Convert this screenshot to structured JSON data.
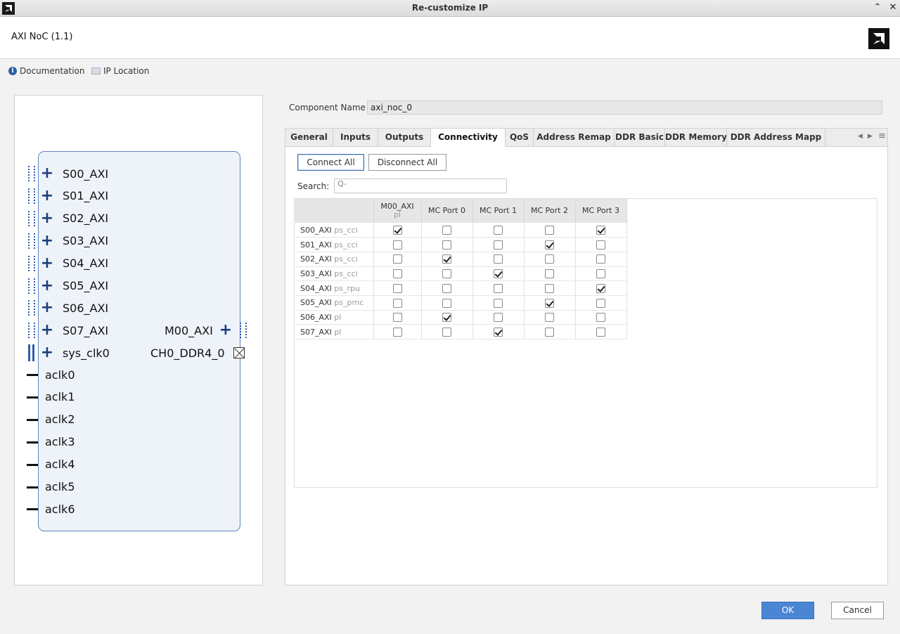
{
  "window": {
    "title": "Re-customize IP"
  },
  "header": {
    "ip_name": "AXI NoC (1.1)"
  },
  "links": {
    "documentation": "Documentation",
    "ip_location": "IP Location"
  },
  "block": {
    "slave_ports": [
      "S00_AXI",
      "S01_AXI",
      "S02_AXI",
      "S03_AXI",
      "S04_AXI",
      "S05_AXI",
      "S06_AXI",
      "S07_AXI"
    ],
    "sys_clk": "sys_clk0",
    "master_port": "M00_AXI",
    "ddr_port": "CH0_DDR4_0",
    "clocks": [
      "aclk0",
      "aclk1",
      "aclk2",
      "aclk3",
      "aclk4",
      "aclk5",
      "aclk6"
    ]
  },
  "component": {
    "label": "Component Name",
    "value": "axi_noc_0"
  },
  "tabs": [
    "General",
    "Inputs",
    "Outputs",
    "Connectivity",
    "QoS",
    "Address Remap",
    "DDR Basic",
    "DDR Memory",
    "DDR Address Mapp"
  ],
  "active_tab": "Connectivity",
  "toolbar": {
    "connect_all": "Connect All",
    "disconnect_all": "Disconnect All"
  },
  "search": {
    "label": "Search:",
    "placeholder": "Q-"
  },
  "matrix": {
    "columns": [
      {
        "name": "M00_AXI",
        "sub": "pl"
      },
      {
        "name": "MC Port 0",
        "sub": ""
      },
      {
        "name": "MC Port 1",
        "sub": ""
      },
      {
        "name": "MC Port 2",
        "sub": ""
      },
      {
        "name": "MC Port 3",
        "sub": ""
      }
    ],
    "rows": [
      {
        "name": "S00_AXI",
        "sub": "ps_cci",
        "checks": [
          true,
          false,
          false,
          false,
          true
        ]
      },
      {
        "name": "S01_AXI",
        "sub": "ps_cci",
        "checks": [
          false,
          false,
          false,
          true,
          false
        ]
      },
      {
        "name": "S02_AXI",
        "sub": "ps_cci",
        "checks": [
          false,
          true,
          false,
          false,
          false
        ]
      },
      {
        "name": "S03_AXI",
        "sub": "ps_cci",
        "checks": [
          false,
          false,
          true,
          false,
          false
        ]
      },
      {
        "name": "S04_AXI",
        "sub": "ps_rpu",
        "checks": [
          false,
          false,
          false,
          false,
          true
        ]
      },
      {
        "name": "S05_AXI",
        "sub": "ps_pmc",
        "checks": [
          false,
          false,
          false,
          true,
          false
        ]
      },
      {
        "name": "S06_AXI",
        "sub": "pl",
        "checks": [
          false,
          true,
          false,
          false,
          false
        ]
      },
      {
        "name": "S07_AXI",
        "sub": "pl",
        "checks": [
          false,
          false,
          true,
          false,
          false
        ]
      }
    ]
  },
  "footer": {
    "ok": "OK",
    "cancel": "Cancel"
  },
  "colors": {
    "accent": "#4a86d3",
    "block_border": "#5f86bf",
    "block_fill": "#eef3fa"
  }
}
